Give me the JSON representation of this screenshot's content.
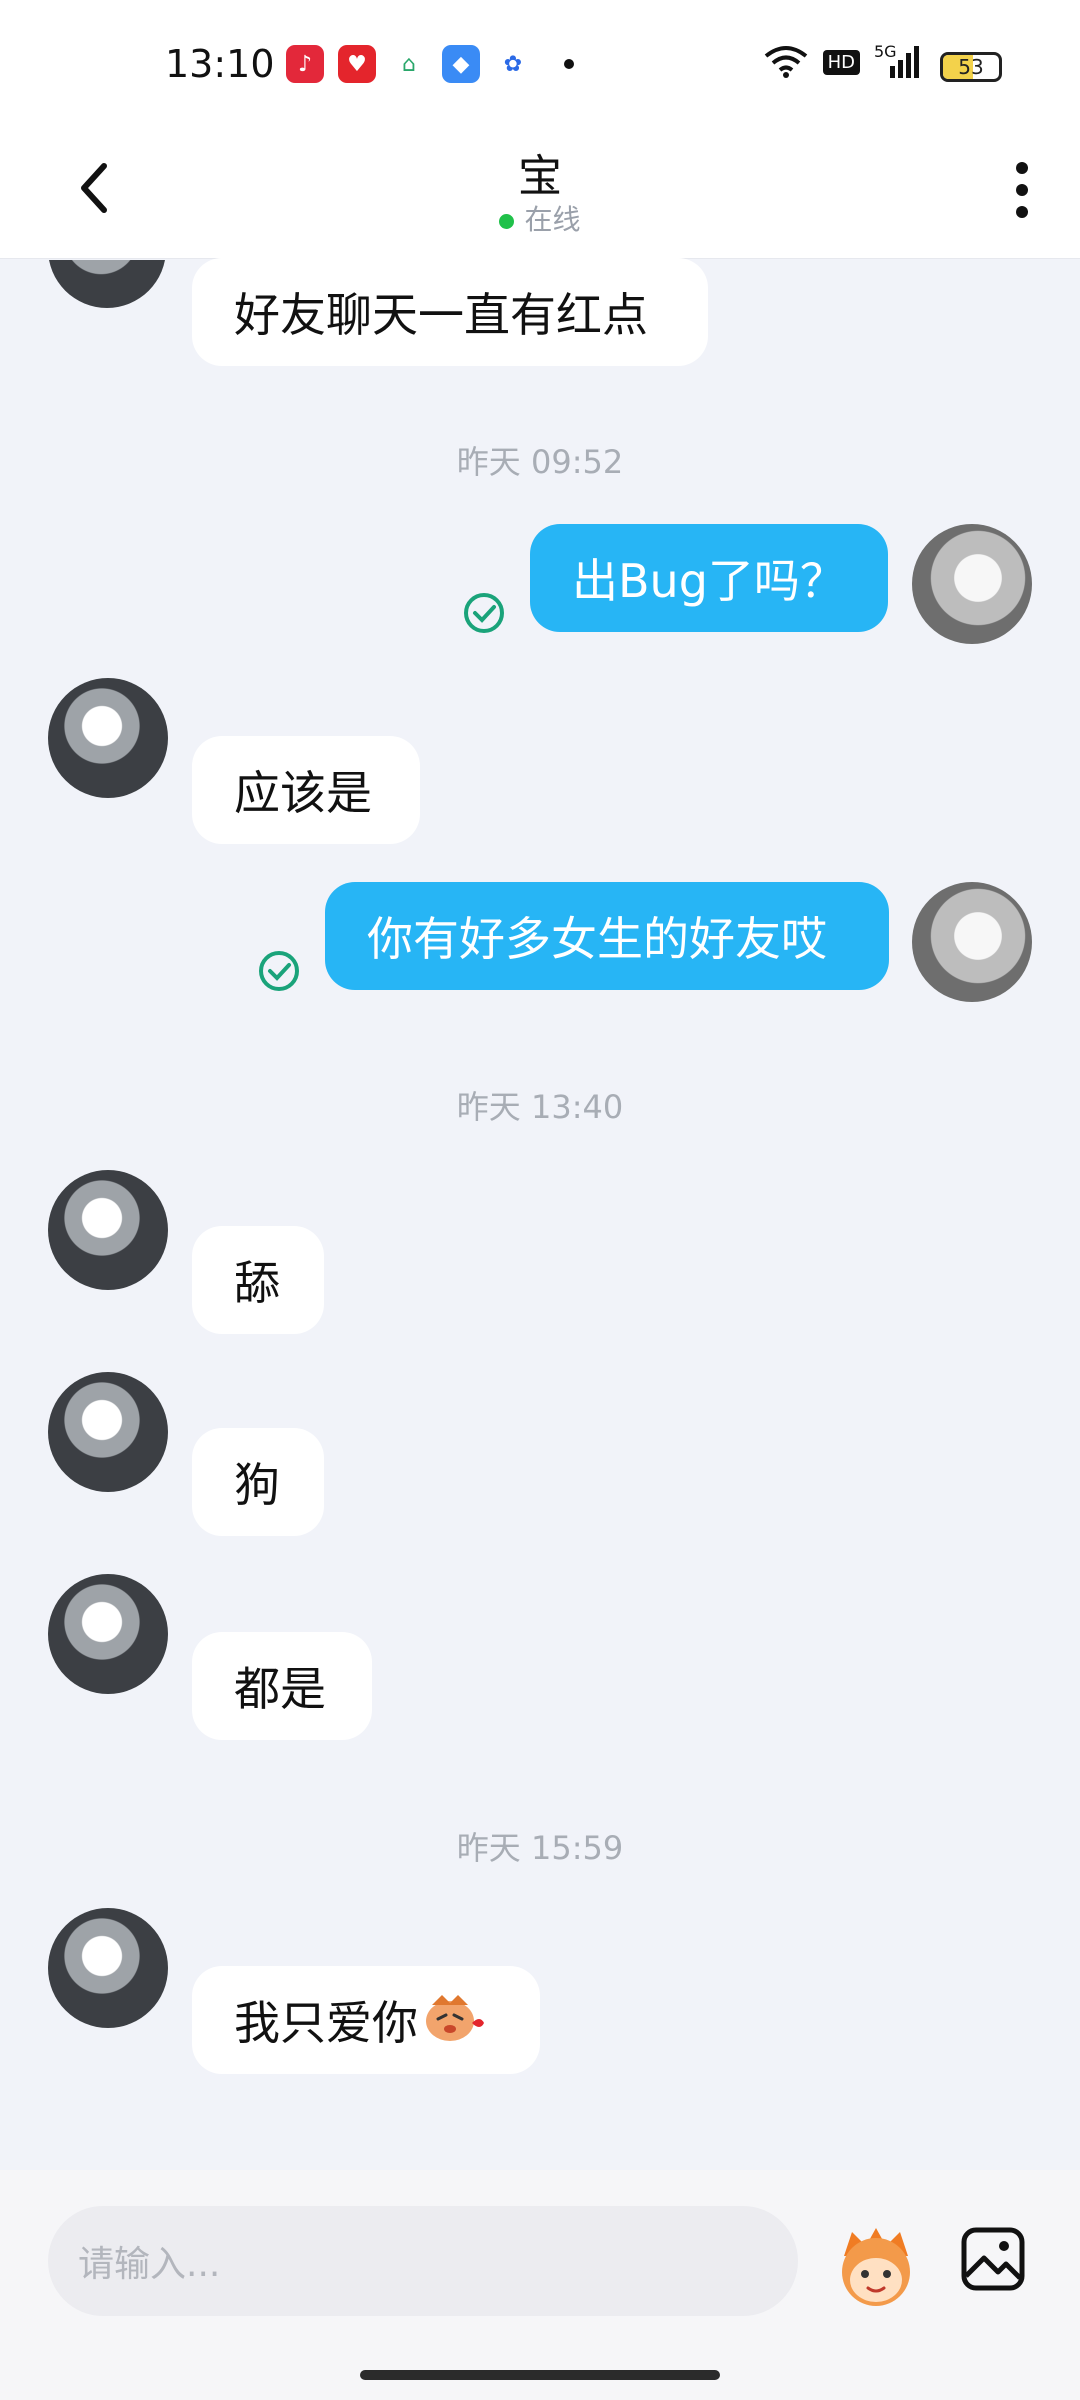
{
  "status": {
    "time": "13:10",
    "battery": "53",
    "network": "5G",
    "hd": "HD",
    "app_icons": [
      "music-icon",
      "heart-app-icon",
      "home-app-icon",
      "browser-icon",
      "baidu-icon"
    ]
  },
  "header": {
    "title": "宝",
    "status_text": "在线"
  },
  "messages": {
    "m0": {
      "text": "好友聊天一直有红点"
    },
    "t1": "昨天 09:52",
    "m1": {
      "text": "出Bug了吗？"
    },
    "m2": {
      "text": "应该是"
    },
    "m3": {
      "text": "你有好多女生的好友哎"
    },
    "t2": "昨天 13:40",
    "m4": {
      "text": "舔"
    },
    "m5": {
      "text": "狗"
    },
    "m6": {
      "text": "都是"
    },
    "t3": "昨天 15:59",
    "m7": {
      "text": "我只爱你"
    }
  },
  "input": {
    "placeholder": "请输入..."
  },
  "colors": {
    "accent": "#27b5f5",
    "online": "#20c14a",
    "read": "#1aa37a"
  }
}
